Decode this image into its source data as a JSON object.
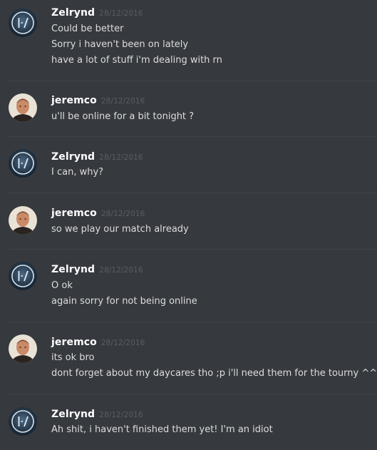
{
  "messages": [
    {
      "author": "Zelrynd",
      "timestamp": "28/12/2016",
      "avatar": "zelrynd-logo-avatar",
      "lines": [
        "Could be better",
        "Sorry i haven't been on lately",
        "have a lot of stuff i'm dealing with rn"
      ]
    },
    {
      "author": "jeremco",
      "timestamp": "28/12/2016",
      "avatar": "jeremco-photo-avatar",
      "lines": [
        "u'll be online for a bit tonight ?"
      ]
    },
    {
      "author": "Zelrynd",
      "timestamp": "28/12/2016",
      "avatar": "zelrynd-logo-avatar",
      "lines": [
        "I can, why?"
      ]
    },
    {
      "author": "jeremco",
      "timestamp": "28/12/2016",
      "avatar": "jeremco-photo-avatar",
      "lines": [
        "so we play our match already"
      ]
    },
    {
      "author": "Zelrynd",
      "timestamp": "28/12/2016",
      "avatar": "zelrynd-logo-avatar",
      "lines": [
        "O ok",
        "again sorry for not being online"
      ]
    },
    {
      "author": "jeremco",
      "timestamp": "28/12/2016",
      "avatar": "jeremco-photo-avatar",
      "lines": [
        "its ok bro",
        "dont forget about my daycares tho ;p i'll need them for the tourny ^^"
      ]
    },
    {
      "author": "Zelrynd",
      "timestamp": "28/12/2016",
      "avatar": "zelrynd-logo-avatar",
      "lines": [
        "Ah shit, i haven't finished them yet! I'm an idiot"
      ]
    }
  ],
  "theme": {
    "background": "#36393e",
    "divider": "#40434a",
    "username": "#ffffff",
    "timestamp": "#5a5d63",
    "text": "#dcddde"
  }
}
